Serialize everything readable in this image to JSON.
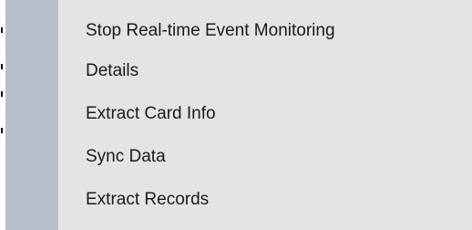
{
  "menu": {
    "items": [
      {
        "label": "Stop Real-time Event Monitoring"
      },
      {
        "label": "Details"
      },
      {
        "label": "Extract Card Info"
      },
      {
        "label": "Sync Data"
      },
      {
        "label": "Extract Records"
      }
    ]
  },
  "colors": {
    "menu_background": "#e4e4e4",
    "gutter": "#b8bfcc",
    "text": "#1a1a1a"
  }
}
